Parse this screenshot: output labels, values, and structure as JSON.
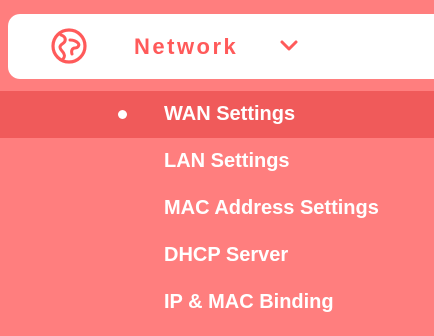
{
  "menu": {
    "icon": "globe-icon",
    "title": "Network",
    "expand_icon": "chevron-down-icon",
    "accent_color": "#ff5a5a",
    "background_color": "#ff7e7e",
    "active_item_color": "#f05a5a"
  },
  "submenu": {
    "items": [
      {
        "label": "WAN Settings",
        "active": true
      },
      {
        "label": "LAN Settings",
        "active": false
      },
      {
        "label": "MAC Address Settings",
        "active": false
      },
      {
        "label": "DHCP Server",
        "active": false
      },
      {
        "label": "IP & MAC Binding",
        "active": false
      }
    ]
  }
}
